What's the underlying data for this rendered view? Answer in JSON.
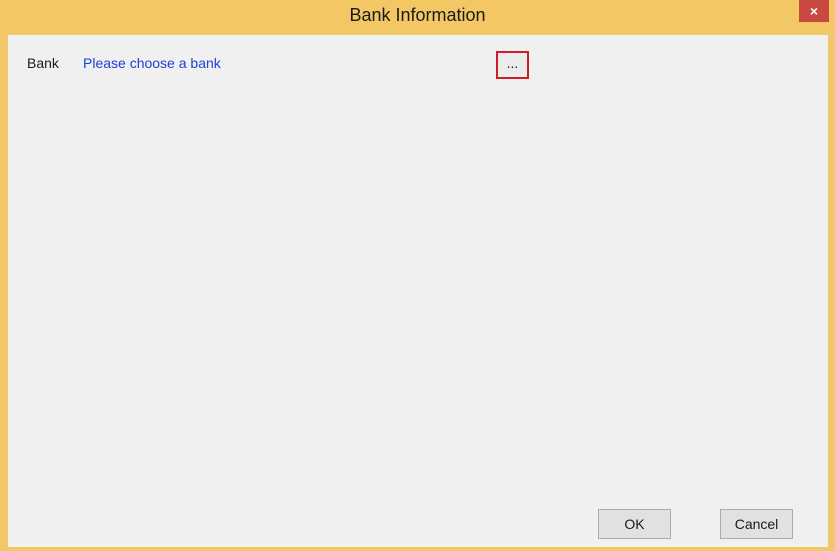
{
  "window": {
    "title": "Bank Information",
    "close_glyph": "×"
  },
  "form": {
    "bank_label": "Bank",
    "bank_value": "Please choose a bank",
    "browse_label": "..."
  },
  "buttons": {
    "ok_label": "OK",
    "cancel_label": "Cancel"
  },
  "colors": {
    "titlebar": "#f2c764",
    "close": "#c9483f",
    "link": "#1c3fd6",
    "highlight": "#cc1d28"
  }
}
